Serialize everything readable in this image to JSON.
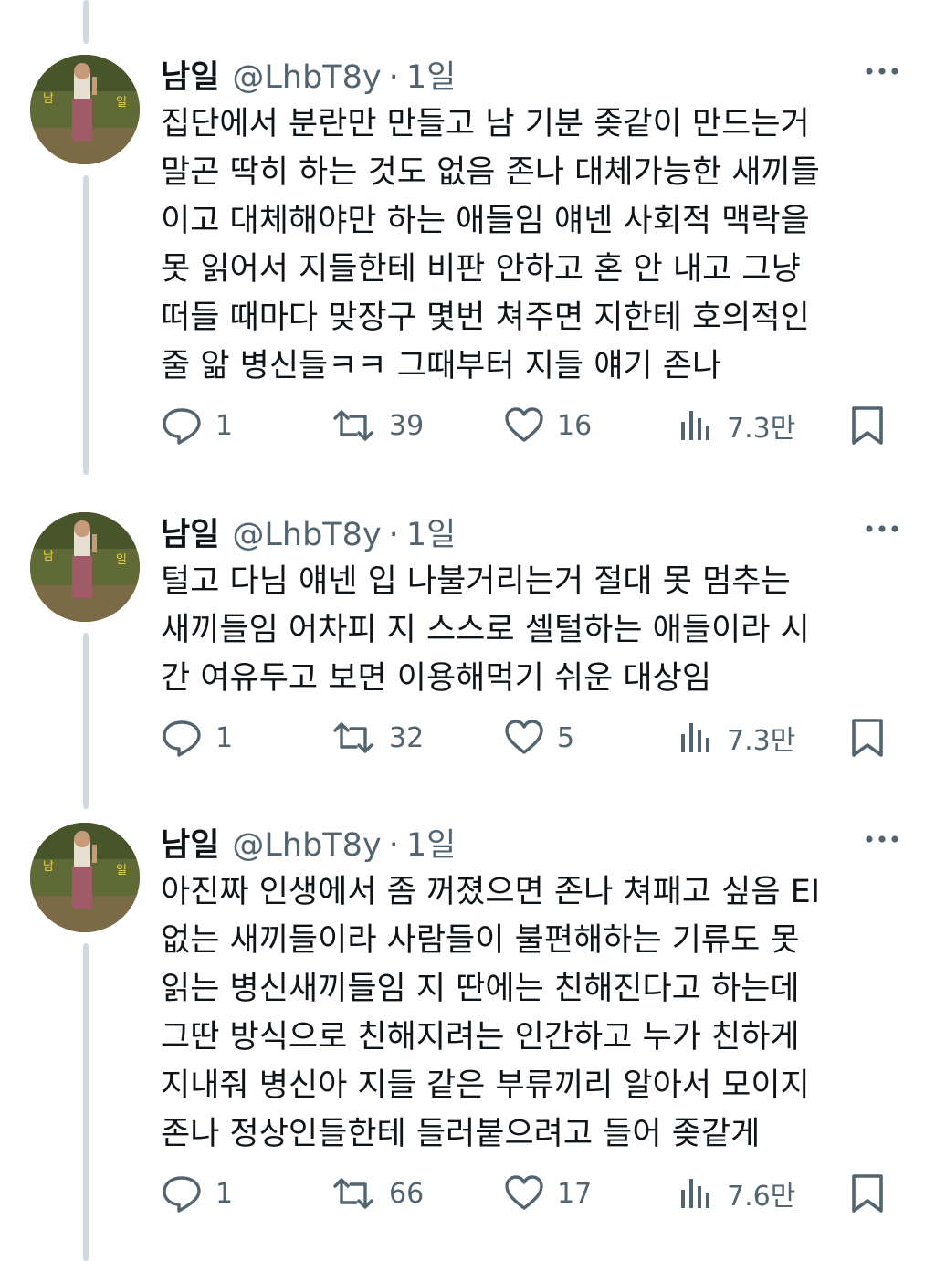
{
  "tweets": [
    {
      "name": "남일",
      "handle": "@LhbT8y",
      "separator": "·",
      "time": "1일",
      "lines": [
        "집단에서 분란만 만들고 남 기분 좆같이 만드는거",
        "말곤 딱히 하는 것도 없음 존나 대체가능한 새끼들",
        "이고 대체해야만 하는 애들임 얘넨 사회적 맥락을",
        "못 읽어서 지들한테 비판 안하고 혼 안 내고 그냥",
        "떠들 때마다 맞장구 몇번 쳐주면 지한테 호의적인",
        "줄 앎 병신들ㅋㅋ 그때부터 지들 얘기 존나"
      ],
      "replies": "1",
      "retweets": "39",
      "likes": "16",
      "views": "7.3만"
    },
    {
      "name": "남일",
      "handle": "@LhbT8y",
      "separator": "·",
      "time": "1일",
      "lines": [
        "털고 다님 얘넨 입 나불거리는거 절대 못 멈추는",
        "새끼들임 어차피 지 스스로 셀털하는 애들이라 시",
        "간 여유두고 보면 이용해먹기 쉬운 대상임"
      ],
      "replies": "1",
      "retweets": "32",
      "likes": "5",
      "views": "7.3만"
    },
    {
      "name": "남일",
      "handle": "@LhbT8y",
      "separator": "·",
      "time": "1일",
      "lines": [
        "아진짜 인생에서 좀 꺼졌으면 존나 쳐패고 싶음 EI",
        "없는 새끼들이라 사람들이 불편해하는 기류도 못",
        "읽는 병신새끼들임 지 딴에는 친해진다고 하는데",
        "그딴 방식으로 친해지려는 인간하고 누가 친하게",
        "지내줘 병신아 지들 같은 부류끼리 알아서 모이지",
        "존나 정상인들한테 들러붙으려고 들어 좆같게"
      ],
      "replies": "1",
      "retweets": "66",
      "likes": "17",
      "views": "7.6만"
    }
  ],
  "icons": {
    "reply": "reply-icon",
    "retweet": "retweet-icon",
    "like": "heart-icon",
    "views": "views-icon",
    "bookmark": "bookmark-icon",
    "more": "more-icon"
  },
  "colors": {
    "text": "#0f1419",
    "secondary": "#536471",
    "thread_line": "#cfd9de"
  }
}
